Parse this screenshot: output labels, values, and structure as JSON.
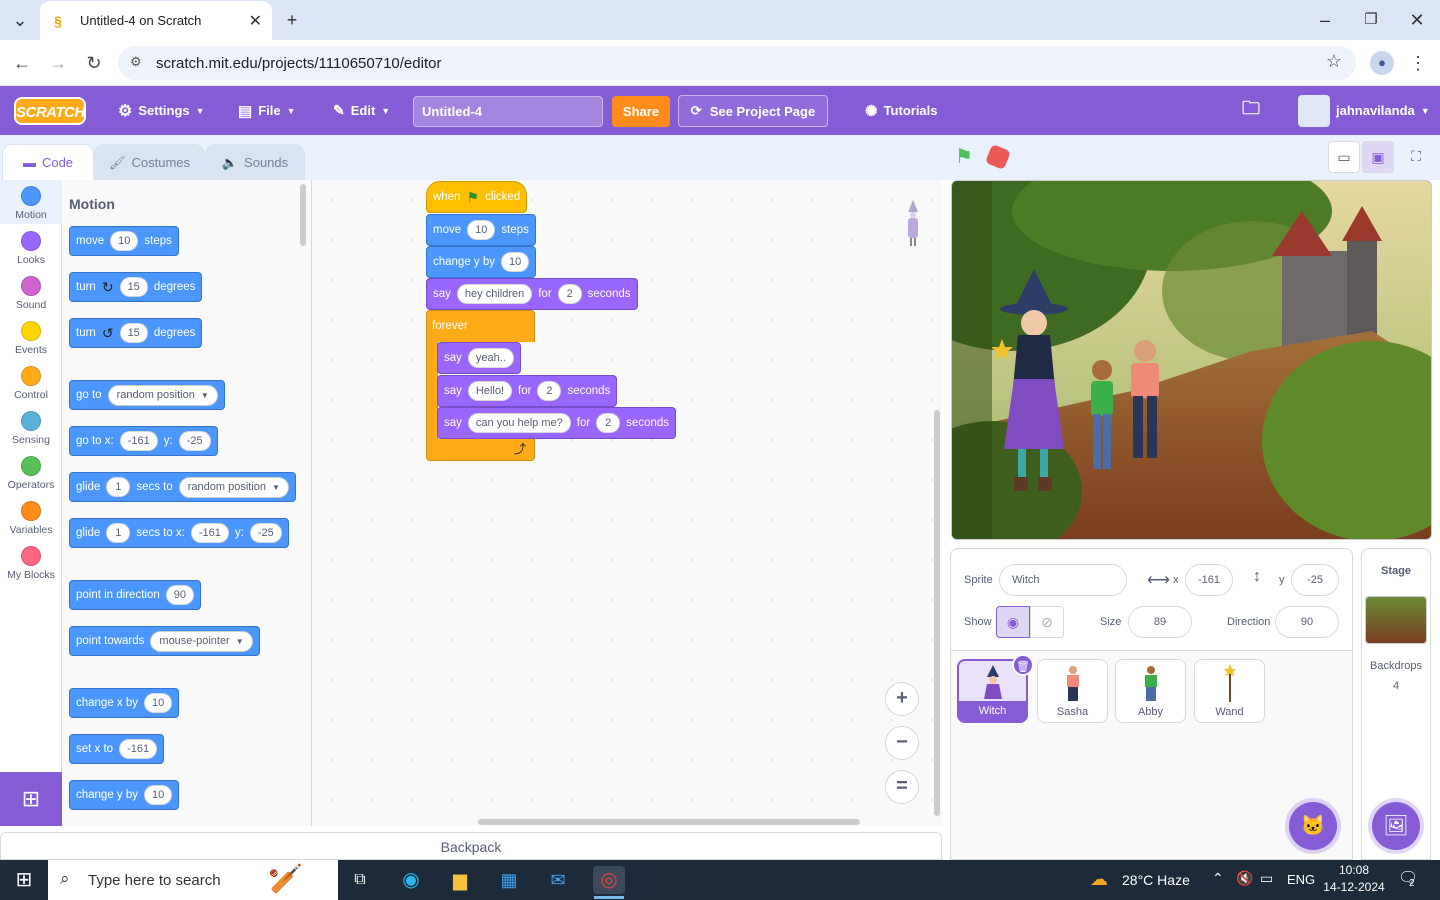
{
  "browser": {
    "tab_title": "Untitled-4 on Scratch",
    "url": "scratch.mit.edu/projects/1110650710/editor"
  },
  "menubar": {
    "logo": "SCRATCH",
    "settings": "Settings",
    "file": "File",
    "edit": "Edit",
    "project_title": "Untitled-4",
    "share": "Share",
    "see_project": "See Project Page",
    "tutorials": "Tutorials",
    "username": "jahnavilanda"
  },
  "editor_tabs": {
    "code": "Code",
    "costumes": "Costumes",
    "sounds": "Sounds"
  },
  "categories": [
    {
      "label": "Motion",
      "color": "#4c97ff"
    },
    {
      "label": "Looks",
      "color": "#9966ff"
    },
    {
      "label": "Sound",
      "color": "#cf63cf"
    },
    {
      "label": "Events",
      "color": "#ffd500"
    },
    {
      "label": "Control",
      "color": "#ffab19"
    },
    {
      "label": "Sensing",
      "color": "#5cb1d6"
    },
    {
      "label": "Operators",
      "color": "#59c059"
    },
    {
      "label": "Variables",
      "color": "#ff8c1a"
    },
    {
      "label": "My Blocks",
      "color": "#ff6680"
    }
  ],
  "palette": {
    "heading": "Motion",
    "b1": {
      "t1": "move",
      "v": "10",
      "t2": "steps"
    },
    "b2": {
      "t1": "turn",
      "v": "15",
      "t2": "degrees"
    },
    "b3": {
      "t1": "turn",
      "v": "15",
      "t2": "degrees"
    },
    "b4": {
      "t1": "go to",
      "dd": "random position"
    },
    "b5": {
      "t1": "go to x:",
      "x": "-161",
      "t2": "y:",
      "y": "-25"
    },
    "b6": {
      "t1": "glide",
      "v": "1",
      "t2": "secs to",
      "dd": "random position"
    },
    "b7": {
      "t1": "glide",
      "v": "1",
      "t2": "secs to x:",
      "x": "-161",
      "t3": "y:",
      "y": "-25"
    },
    "b8": {
      "t1": "point in direction",
      "v": "90"
    },
    "b9": {
      "t1": "point towards",
      "dd": "mouse-pointer"
    },
    "b10": {
      "t1": "change x by",
      "v": "10"
    },
    "b11": {
      "t1": "set x to",
      "v": "-161"
    },
    "b12": {
      "t1": "change y by",
      "v": "10"
    }
  },
  "script": {
    "hat": {
      "t1": "when",
      "t2": "clicked"
    },
    "move": {
      "t1": "move",
      "v": "10",
      "t2": "steps"
    },
    "changey": {
      "t1": "change y by",
      "v": "10"
    },
    "say1": {
      "t1": "say",
      "msg": "hey children",
      "t2": "for",
      "secs": "2",
      "t3": "seconds"
    },
    "forever": "forever",
    "say2": {
      "t1": "say",
      "msg": "yeah.."
    },
    "say3": {
      "t1": "say",
      "msg": "Hello!",
      "t2": "for",
      "secs": "2",
      "t3": "seconds"
    },
    "say4": {
      "t1": "say",
      "msg": "can you help me?",
      "t2": "for",
      "secs": "2",
      "t3": "seconds"
    }
  },
  "zoom": {
    "in": "+",
    "out": "−",
    "reset": "="
  },
  "backpack": "Backpack",
  "sprite_info": {
    "sprite_label": "Sprite",
    "sprite_name": "Witch",
    "x_label": "x",
    "x": "-161",
    "y_label": "y",
    "y": "-25",
    "show_label": "Show",
    "size_label": "Size",
    "size": "89",
    "direction_label": "Direction",
    "direction": "90"
  },
  "sprites": [
    "Witch",
    "Sasha",
    "Abby",
    "Wand"
  ],
  "stage_panel": {
    "title": "Stage",
    "backdrops_label": "Backdrops",
    "backdrops_count": "4"
  },
  "taskbar": {
    "search_placeholder": "Type here to search",
    "weather": "28°C  Haze",
    "lang": "ENG",
    "time": "10:08",
    "date": "14-12-2024",
    "notif": "2"
  }
}
